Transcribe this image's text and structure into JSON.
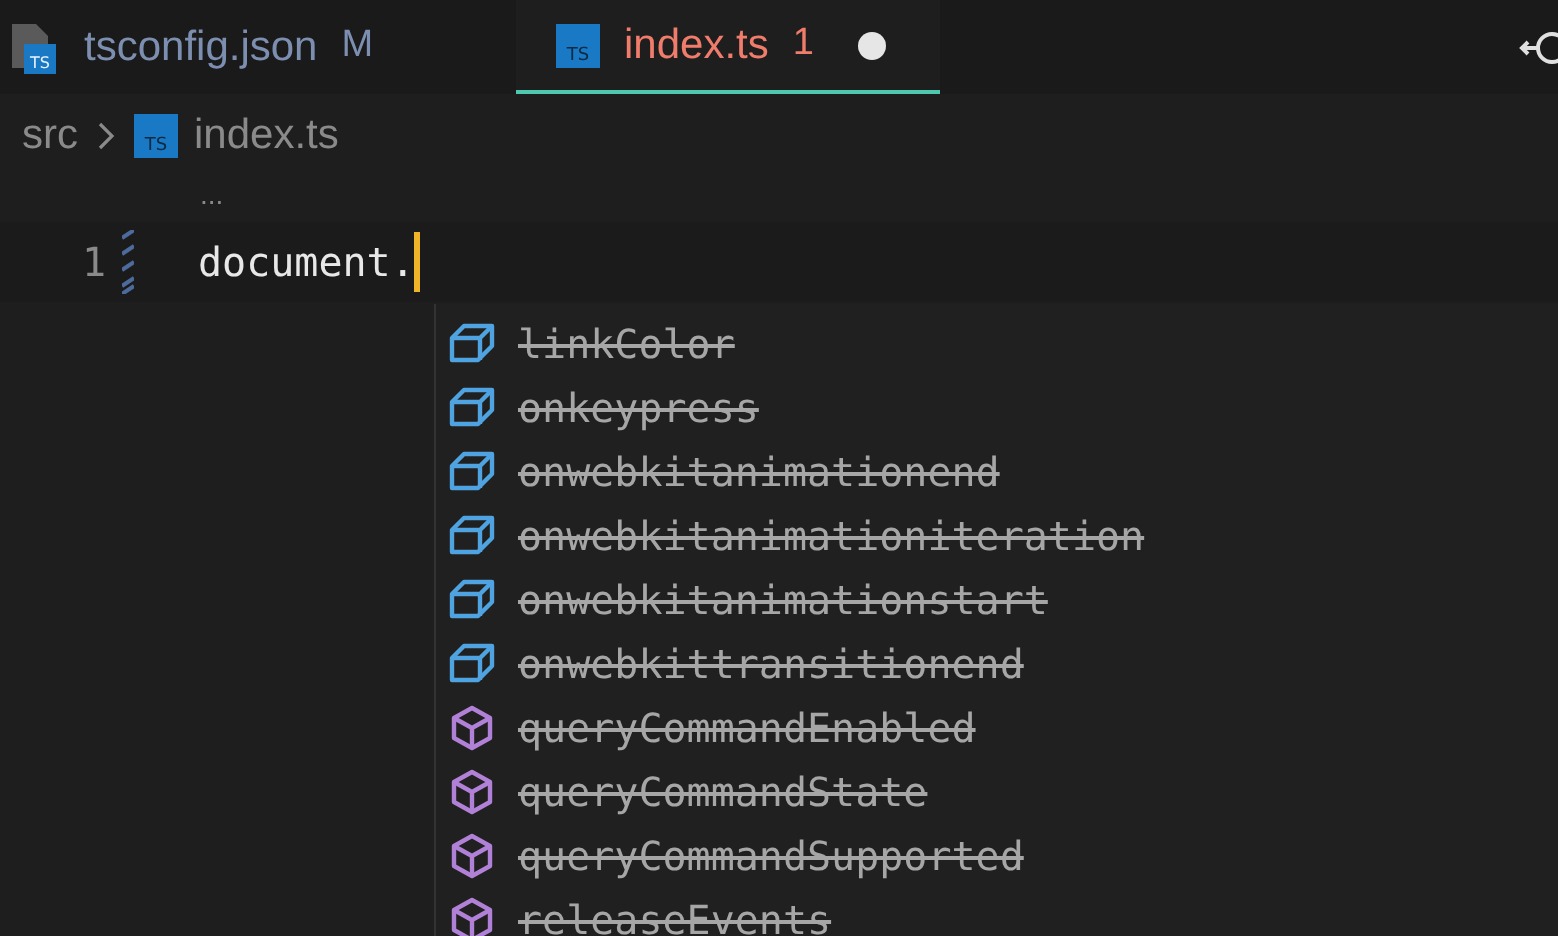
{
  "tabs": [
    {
      "label": "tsconfig.json",
      "icon_text": "TS",
      "badge": "M",
      "selected": false,
      "dirty": false,
      "error": false
    },
    {
      "label": "index.ts",
      "icon_text": "TS",
      "badge": "1",
      "selected": true,
      "dirty": true,
      "error": true
    }
  ],
  "breadcrumb": {
    "folder": "src",
    "file": "index.ts",
    "icon_text": "TS"
  },
  "editor": {
    "fold_marker": "...",
    "lines": [
      {
        "number": "1",
        "code": "document."
      }
    ]
  },
  "suggestions": [
    {
      "label": "linkColor",
      "kind": "property",
      "deprecated": true
    },
    {
      "label": "onkeypress",
      "kind": "property",
      "deprecated": true
    },
    {
      "label": "onwebkitanimationend",
      "kind": "property",
      "deprecated": true
    },
    {
      "label": "onwebkitanimationiteration",
      "kind": "property",
      "deprecated": true
    },
    {
      "label": "onwebkitanimationstart",
      "kind": "property",
      "deprecated": true
    },
    {
      "label": "onwebkittransitionend",
      "kind": "property",
      "deprecated": true
    },
    {
      "label": "queryCommandEnabled",
      "kind": "method",
      "deprecated": true
    },
    {
      "label": "queryCommandState",
      "kind": "method",
      "deprecated": true
    },
    {
      "label": "queryCommandSupported",
      "kind": "method",
      "deprecated": true
    },
    {
      "label": "releaseEvents",
      "kind": "method",
      "deprecated": true
    }
  ]
}
